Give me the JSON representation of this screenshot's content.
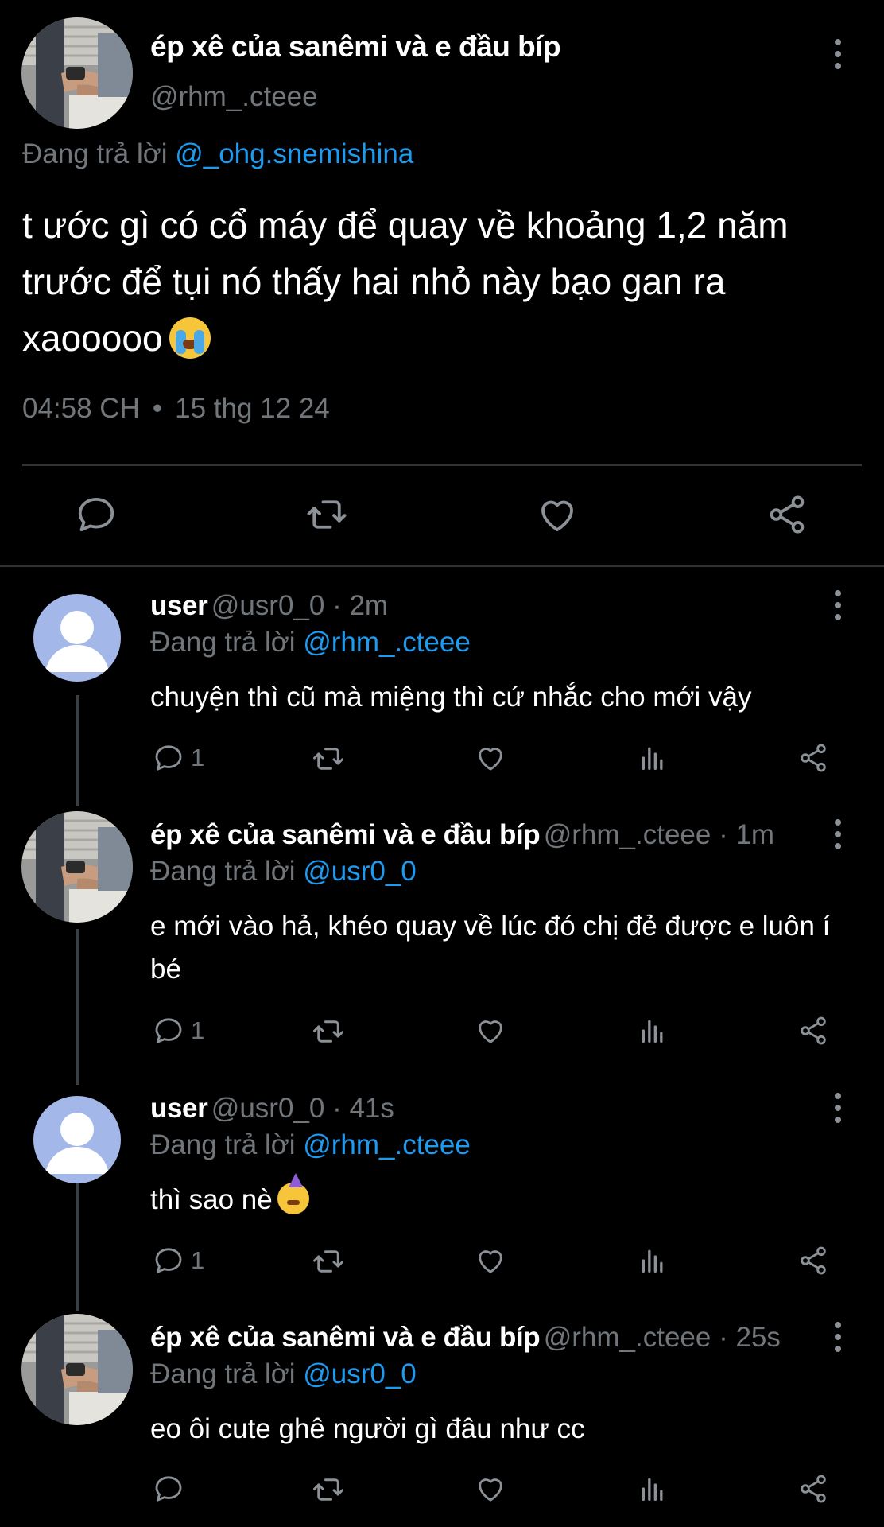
{
  "main": {
    "name": "ép xê của sanêmi và e đầu bíp",
    "handle": "@rhm_.cteee",
    "replying_prefix": "Đang trả lời",
    "replying_to": "@_ohg.snemishina",
    "text": "t ước gì có cổ máy để quay về khoảng 1,2 năm trước để tụi nó thấy hai nhỏ này bạo gan ra xaooooo",
    "emoji": "loudly-crying-face-emoji",
    "time": "04:58 CH",
    "dot": "•",
    "date": "15 thg 12 24"
  },
  "replies": [
    {
      "name": "user",
      "handle": "@usr0_0",
      "sep": "·",
      "time": "2m",
      "replying_prefix": "Đang trả lời",
      "replying_to": "@rhm_.cteee",
      "text": "chuyện thì cũ mà miệng thì cứ nhắc cho mới vậy",
      "reply_count": "1"
    },
    {
      "name": "ép xê của sanêmi và e đầu bíp",
      "handle": "@rhm_.cteee",
      "sep": "·",
      "time": "1m",
      "replying_prefix": "Đang trả lời",
      "replying_to": "@usr0_0",
      "text": "e mới vào hả, khéo quay về lúc đó chị đẻ được e luôn í bé",
      "reply_count": "1"
    },
    {
      "name": "user",
      "handle": "@usr0_0",
      "sep": "·",
      "time": "41s",
      "replying_prefix": "Đang trả lời",
      "replying_to": "@rhm_.cteee",
      "text": "thì sao nè",
      "emoji": "partying-face-emoji",
      "reply_count": "1"
    },
    {
      "name": "ép xê của sanêmi và e đầu bíp",
      "handle": "@rhm_.cteee",
      "sep": "·",
      "time": "25s",
      "replying_prefix": "Đang trả lời",
      "replying_to": "@usr0_0",
      "text": "eo ôi cute ghê người gì đâu như cc",
      "reply_count": ""
    }
  ],
  "colors": {
    "background": "#000000",
    "text": "#ffffff",
    "muted": "#71767b",
    "mention": "#1d9bf0",
    "default_avatar": "#a3b8e8"
  }
}
